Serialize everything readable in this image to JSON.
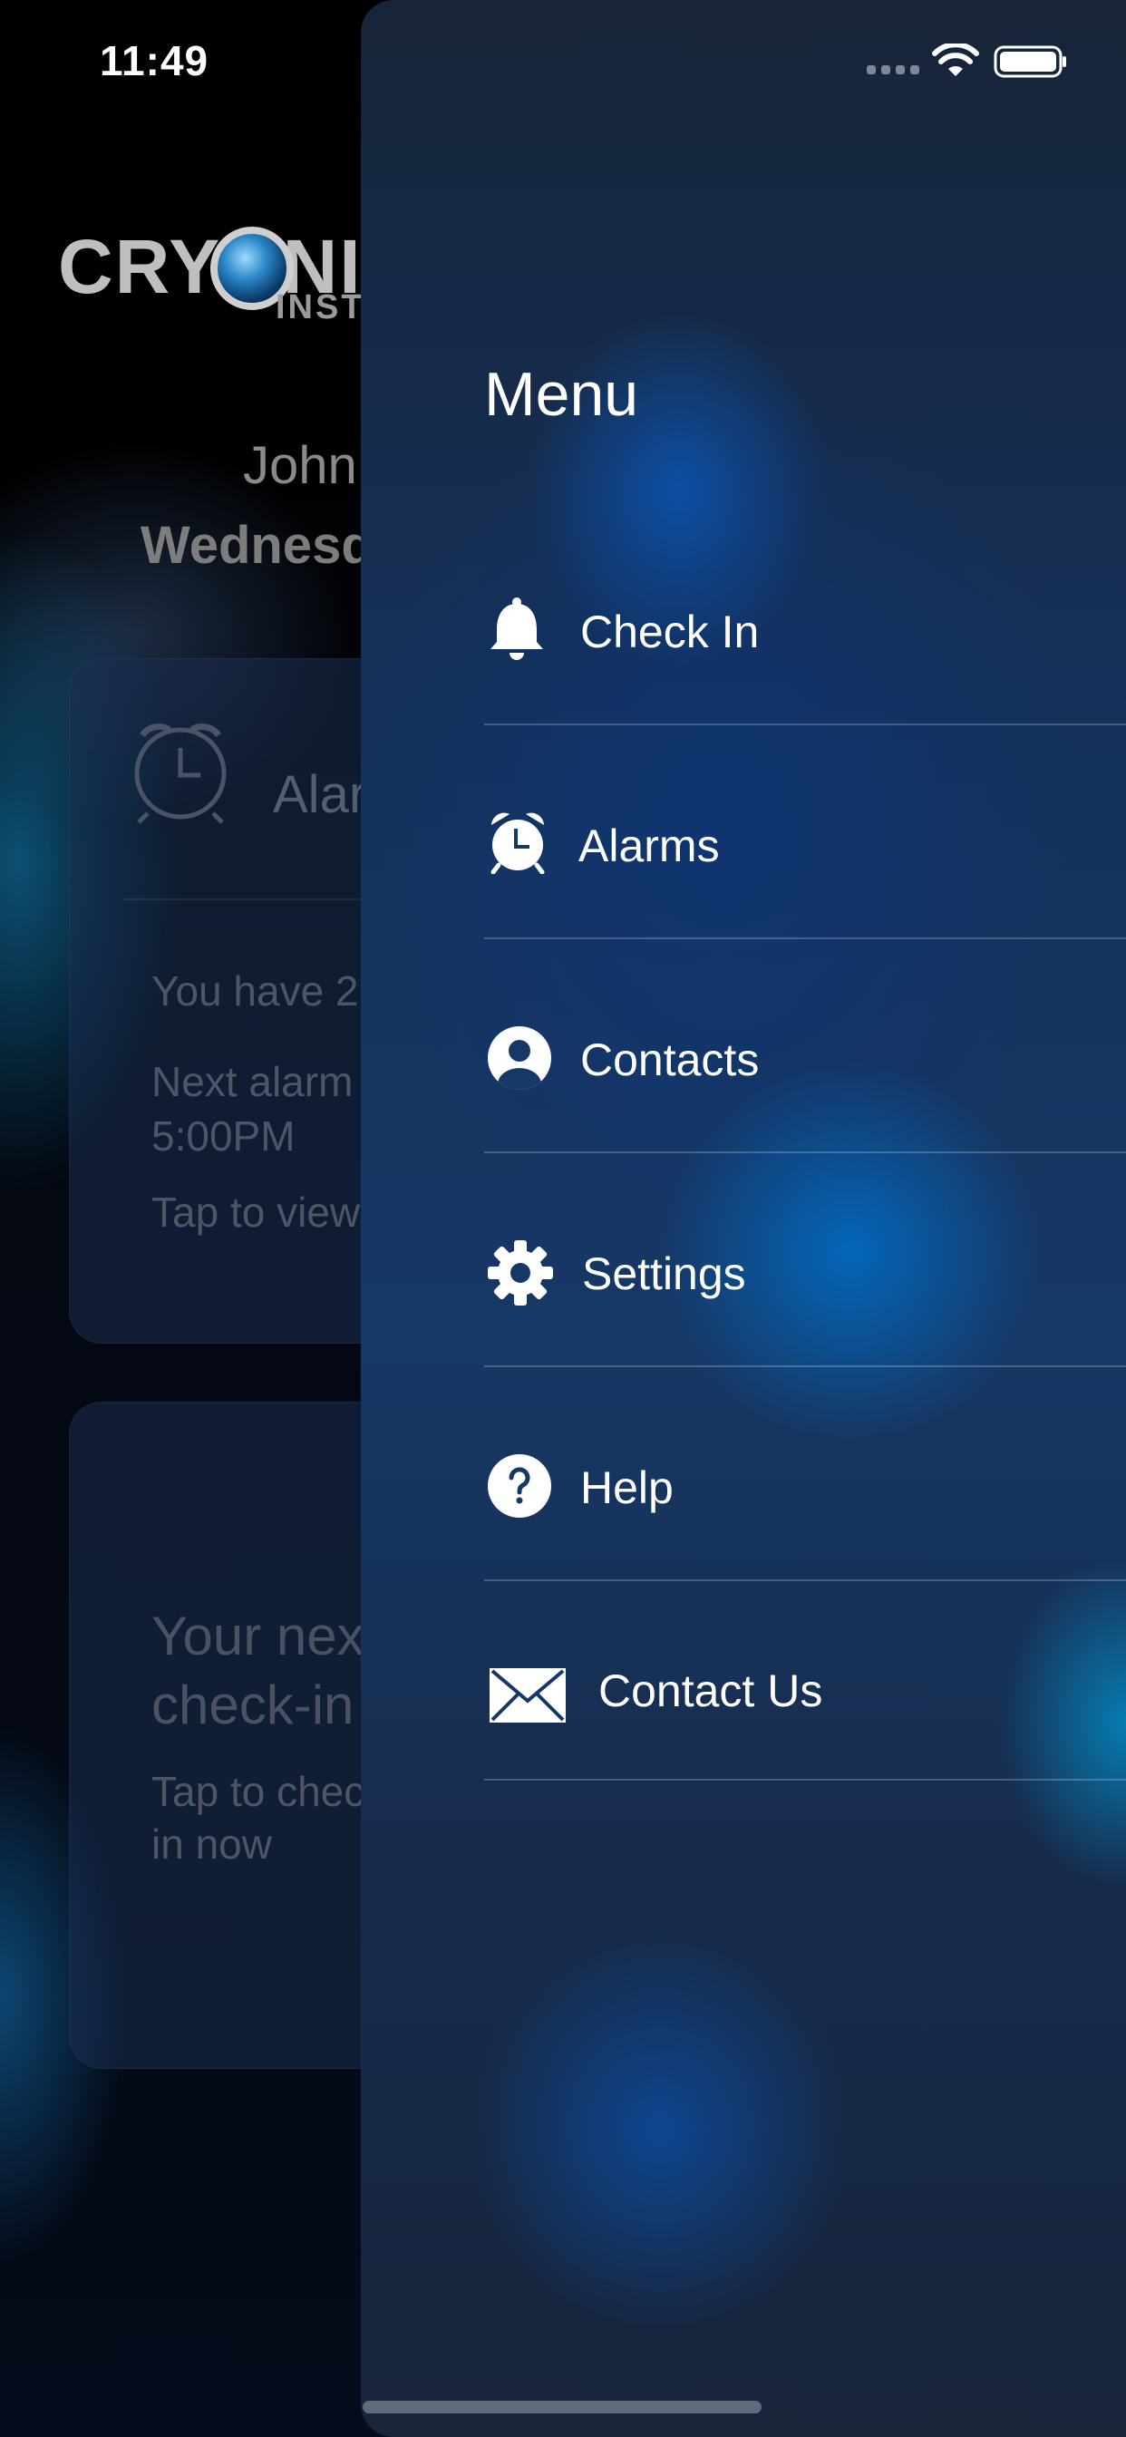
{
  "status_bar": {
    "time": "11:49",
    "signal_icon": "signal-dots-icon",
    "wifi_icon": "wifi-icon",
    "battery_icon": "battery-icon"
  },
  "background": {
    "logo": {
      "main": "CRYONICS",
      "sub": "INSTITUTE"
    },
    "user_name": "John",
    "weekday": "Wednesday",
    "alarms_card": {
      "icon": "alarm-clock-icon",
      "title": "Alarms",
      "summary": "You have 2",
      "next_alarm": "Next alarm",
      "next_time": "5:00PM",
      "tap_text": "Tap to view"
    },
    "checkin_card": {
      "line1": "Your next",
      "line2": "check-in",
      "tap_line1": "Tap to check",
      "tap_line2": "in now"
    }
  },
  "drawer": {
    "title": "Menu",
    "items": [
      {
        "label": "Check In",
        "icon": "bell-icon"
      },
      {
        "label": "Alarms",
        "icon": "alarm-clock-icon"
      },
      {
        "label": "Contacts",
        "icon": "person-circle-icon"
      },
      {
        "label": "Settings",
        "icon": "gear-icon"
      },
      {
        "label": "Help",
        "icon": "question-circle-icon"
      },
      {
        "label": "Contact Us",
        "icon": "envelope-icon"
      }
    ]
  },
  "colors": {
    "drawer_top": "#172439",
    "drawer_mid": "#163866",
    "accent_glow": "#0a6ec8",
    "divider": "rgba(255,255,255,0.22)"
  }
}
